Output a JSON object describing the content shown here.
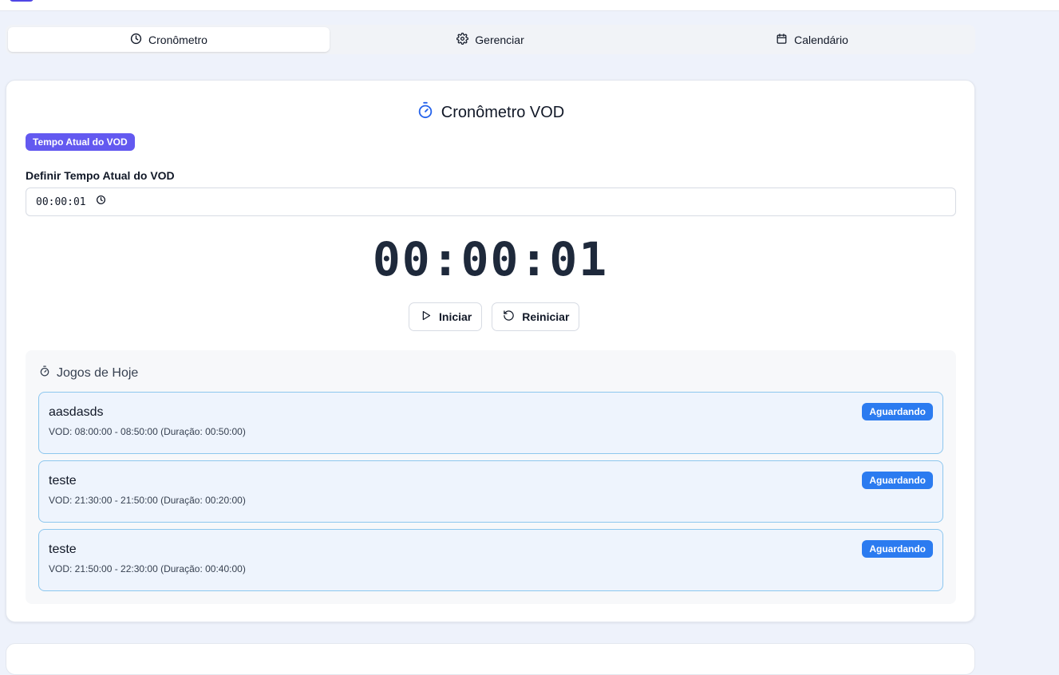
{
  "tabs": [
    {
      "label": "Cronômetro",
      "icon": "clock-icon",
      "active": true
    },
    {
      "label": "Gerenciar",
      "icon": "gear-icon",
      "active": false
    },
    {
      "label": "Calendário",
      "icon": "calendar-icon",
      "active": false
    }
  ],
  "timer": {
    "title": "Cronômetro VOD",
    "badge": "Tempo Atual do VOD",
    "field_label": "Definir Tempo Atual do VOD",
    "input_value": "00:00:01",
    "display": "00:00:01",
    "start_label": "Iniciar",
    "reset_label": "Reiniciar"
  },
  "games": {
    "title": "Jogos de Hoje",
    "items": [
      {
        "name": "aasdasds",
        "info": "VOD: 08:00:00 - 08:50:00 (Duração: 00:50:00)",
        "status": "Aguardando"
      },
      {
        "name": "teste",
        "info": "VOD: 21:30:00 - 21:50:00 (Duração: 00:20:00)",
        "status": "Aguardando"
      },
      {
        "name": "teste",
        "info": "VOD: 21:50:00 - 22:30:00 (Duração: 00:40:00)",
        "status": "Aguardando"
      }
    ]
  },
  "colors": {
    "accent_purple": "#6359f0",
    "status_blue": "#2b7bf0",
    "timer_icon_blue": "#2563eb",
    "game_border": "#8dc7ee"
  }
}
